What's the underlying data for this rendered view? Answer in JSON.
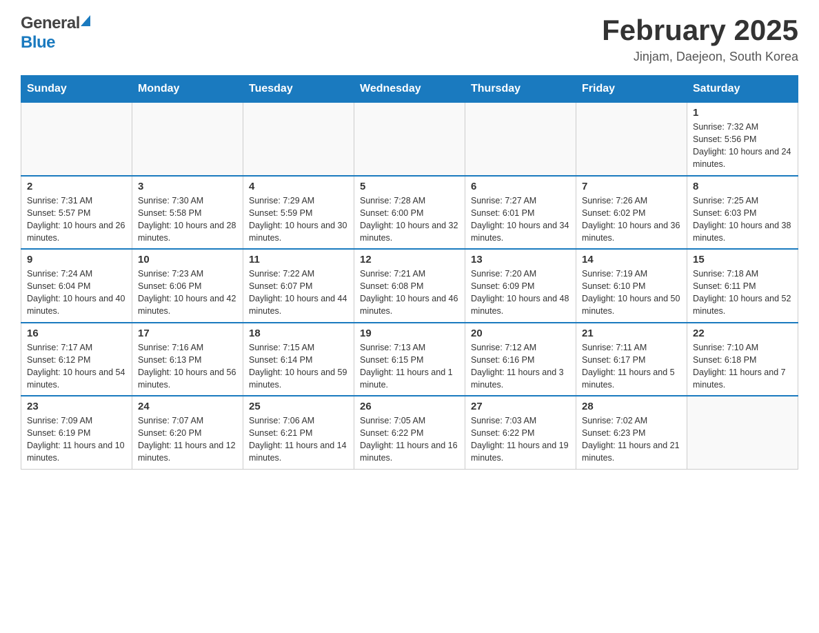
{
  "header": {
    "logo_general": "General",
    "logo_blue": "Blue",
    "month_title": "February 2025",
    "location": "Jinjam, Daejeon, South Korea"
  },
  "days_of_week": [
    "Sunday",
    "Monday",
    "Tuesday",
    "Wednesday",
    "Thursday",
    "Friday",
    "Saturday"
  ],
  "weeks": [
    [
      {
        "day": "",
        "info": ""
      },
      {
        "day": "",
        "info": ""
      },
      {
        "day": "",
        "info": ""
      },
      {
        "day": "",
        "info": ""
      },
      {
        "day": "",
        "info": ""
      },
      {
        "day": "",
        "info": ""
      },
      {
        "day": "1",
        "info": "Sunrise: 7:32 AM\nSunset: 5:56 PM\nDaylight: 10 hours and 24 minutes."
      }
    ],
    [
      {
        "day": "2",
        "info": "Sunrise: 7:31 AM\nSunset: 5:57 PM\nDaylight: 10 hours and 26 minutes."
      },
      {
        "day": "3",
        "info": "Sunrise: 7:30 AM\nSunset: 5:58 PM\nDaylight: 10 hours and 28 minutes."
      },
      {
        "day": "4",
        "info": "Sunrise: 7:29 AM\nSunset: 5:59 PM\nDaylight: 10 hours and 30 minutes."
      },
      {
        "day": "5",
        "info": "Sunrise: 7:28 AM\nSunset: 6:00 PM\nDaylight: 10 hours and 32 minutes."
      },
      {
        "day": "6",
        "info": "Sunrise: 7:27 AM\nSunset: 6:01 PM\nDaylight: 10 hours and 34 minutes."
      },
      {
        "day": "7",
        "info": "Sunrise: 7:26 AM\nSunset: 6:02 PM\nDaylight: 10 hours and 36 minutes."
      },
      {
        "day": "8",
        "info": "Sunrise: 7:25 AM\nSunset: 6:03 PM\nDaylight: 10 hours and 38 minutes."
      }
    ],
    [
      {
        "day": "9",
        "info": "Sunrise: 7:24 AM\nSunset: 6:04 PM\nDaylight: 10 hours and 40 minutes."
      },
      {
        "day": "10",
        "info": "Sunrise: 7:23 AM\nSunset: 6:06 PM\nDaylight: 10 hours and 42 minutes."
      },
      {
        "day": "11",
        "info": "Sunrise: 7:22 AM\nSunset: 6:07 PM\nDaylight: 10 hours and 44 minutes."
      },
      {
        "day": "12",
        "info": "Sunrise: 7:21 AM\nSunset: 6:08 PM\nDaylight: 10 hours and 46 minutes."
      },
      {
        "day": "13",
        "info": "Sunrise: 7:20 AM\nSunset: 6:09 PM\nDaylight: 10 hours and 48 minutes."
      },
      {
        "day": "14",
        "info": "Sunrise: 7:19 AM\nSunset: 6:10 PM\nDaylight: 10 hours and 50 minutes."
      },
      {
        "day": "15",
        "info": "Sunrise: 7:18 AM\nSunset: 6:11 PM\nDaylight: 10 hours and 52 minutes."
      }
    ],
    [
      {
        "day": "16",
        "info": "Sunrise: 7:17 AM\nSunset: 6:12 PM\nDaylight: 10 hours and 54 minutes."
      },
      {
        "day": "17",
        "info": "Sunrise: 7:16 AM\nSunset: 6:13 PM\nDaylight: 10 hours and 56 minutes."
      },
      {
        "day": "18",
        "info": "Sunrise: 7:15 AM\nSunset: 6:14 PM\nDaylight: 10 hours and 59 minutes."
      },
      {
        "day": "19",
        "info": "Sunrise: 7:13 AM\nSunset: 6:15 PM\nDaylight: 11 hours and 1 minute."
      },
      {
        "day": "20",
        "info": "Sunrise: 7:12 AM\nSunset: 6:16 PM\nDaylight: 11 hours and 3 minutes."
      },
      {
        "day": "21",
        "info": "Sunrise: 7:11 AM\nSunset: 6:17 PM\nDaylight: 11 hours and 5 minutes."
      },
      {
        "day": "22",
        "info": "Sunrise: 7:10 AM\nSunset: 6:18 PM\nDaylight: 11 hours and 7 minutes."
      }
    ],
    [
      {
        "day": "23",
        "info": "Sunrise: 7:09 AM\nSunset: 6:19 PM\nDaylight: 11 hours and 10 minutes."
      },
      {
        "day": "24",
        "info": "Sunrise: 7:07 AM\nSunset: 6:20 PM\nDaylight: 11 hours and 12 minutes."
      },
      {
        "day": "25",
        "info": "Sunrise: 7:06 AM\nSunset: 6:21 PM\nDaylight: 11 hours and 14 minutes."
      },
      {
        "day": "26",
        "info": "Sunrise: 7:05 AM\nSunset: 6:22 PM\nDaylight: 11 hours and 16 minutes."
      },
      {
        "day": "27",
        "info": "Sunrise: 7:03 AM\nSunset: 6:22 PM\nDaylight: 11 hours and 19 minutes."
      },
      {
        "day": "28",
        "info": "Sunrise: 7:02 AM\nSunset: 6:23 PM\nDaylight: 11 hours and 21 minutes."
      },
      {
        "day": "",
        "info": ""
      }
    ]
  ]
}
